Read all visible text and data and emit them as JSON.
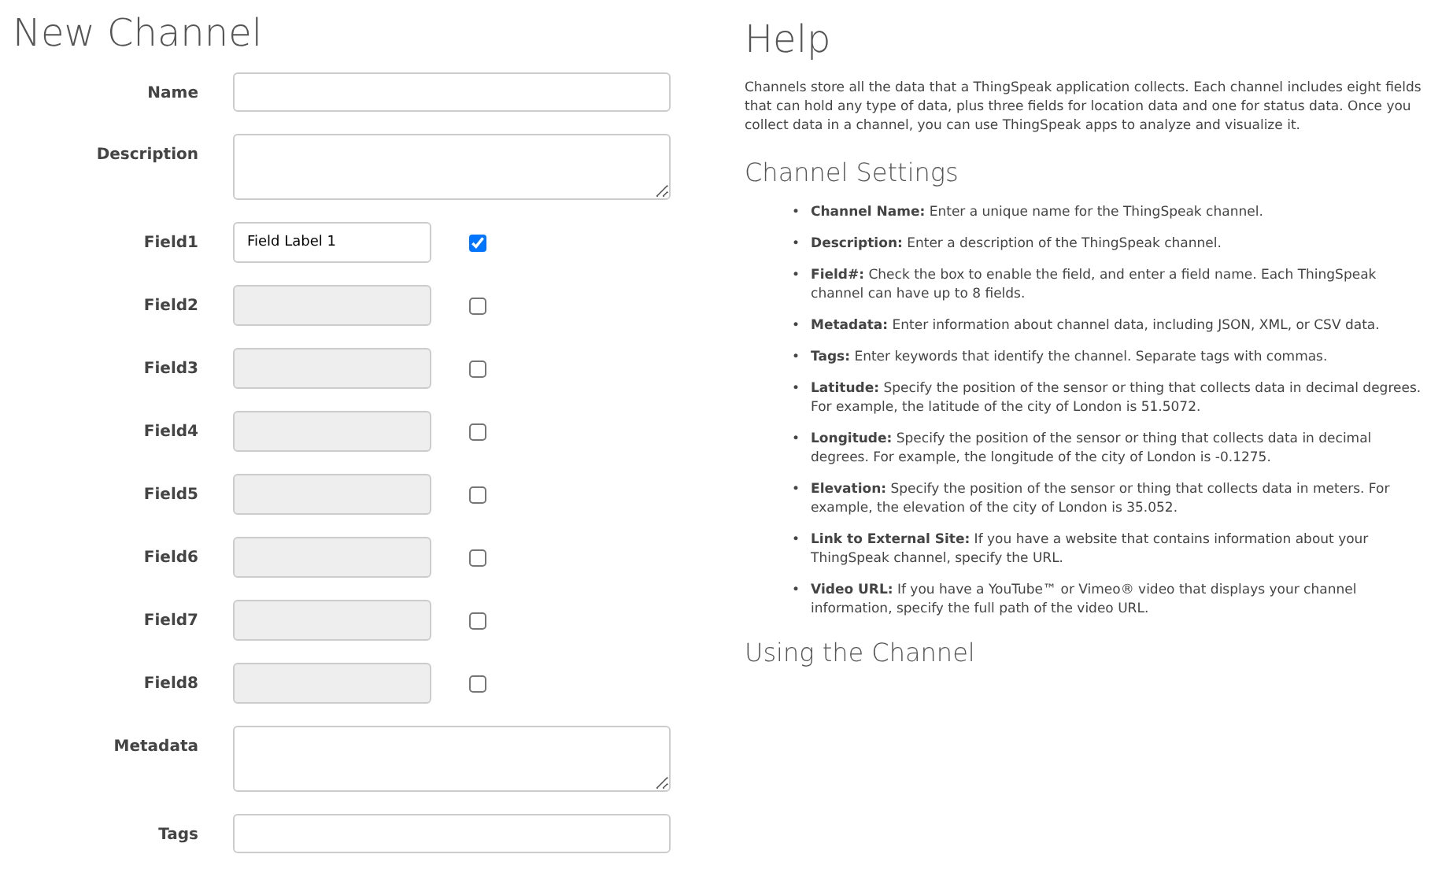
{
  "form": {
    "title": "New Channel",
    "fields": [
      {
        "kind": "input",
        "label": "Name"
      },
      {
        "kind": "textarea",
        "label": "Description"
      },
      {
        "kind": "field",
        "label": "Field1",
        "value": "Field Label 1",
        "checked": true,
        "disabled": false
      },
      {
        "kind": "field",
        "label": "Field2",
        "checked": false,
        "disabled": true
      },
      {
        "kind": "field",
        "label": "Field3",
        "checked": false,
        "disabled": true
      },
      {
        "kind": "field",
        "label": "Field4",
        "checked": false,
        "disabled": true
      },
      {
        "kind": "field",
        "label": "Field5",
        "checked": false,
        "disabled": true
      },
      {
        "kind": "field",
        "label": "Field6",
        "checked": false,
        "disabled": true
      },
      {
        "kind": "field",
        "label": "Field7",
        "checked": false,
        "disabled": true
      },
      {
        "kind": "field",
        "label": "Field8",
        "checked": false,
        "disabled": true
      },
      {
        "kind": "textarea",
        "label": "Metadata"
      },
      {
        "kind": "input",
        "label": "Tags"
      }
    ]
  },
  "help": {
    "title": "Help",
    "intro": "Channels store all the data that a ThingSpeak application collects. Each channel includes eight fields that can hold any type of data, plus three fields for location data and one for status data. Once you collect data in a channel, you can use ThingSpeak apps to analyze and visualize it.",
    "sections": [
      {
        "title": "Channel Settings",
        "items": [
          {
            "bullet": "•",
            "text": "**Channel Name:** Enter a unique name for the ThingSpeak channel."
          },
          {
            "bullet": "•",
            "text": "**Description:** Enter a description of the ThingSpeak channel."
          },
          {
            "bullet": "•",
            "text": "**Field#:** Check the box to enable the field, and enter a field name. Each ThingSpeak channel can have up to 8 fields."
          },
          {
            "bullet": "•",
            "text": "**Metadata:** Enter information about channel data, including JSON, XML, or CSV data."
          },
          {
            "bullet": "•",
            "text": "**Tags:** Enter keywords that identify the channel. Separate tags with commas."
          },
          {
            "bullet": "•",
            "text": "**Latitude:** Specify the position of the sensor or thing that collects data in decimal degrees. For example, the latitude of the city of London is 51.5072."
          },
          {
            "bullet": "•",
            "text": "**Longitude:** Specify the position of the sensor or thing that collects data in decimal degrees. For example, the longitude of the city of London is -0.1275."
          },
          {
            "bullet": "•",
            "text": "**Elevation:** Specify the position of the sensor or thing that collects data in meters. For example, the elevation of the city of London is 35.052."
          },
          {
            "bullet": "•",
            "text": "**Link to External Site:** If you have a website that contains information about your ThingSpeak channel, specify the URL."
          },
          {
            "bullet": "•",
            "text": "**Video URL:** If you have a YouTube™ or Vimeo® video that displays your channel information, specify the full path of the video URL."
          }
        ]
      },
      {
        "title": "Using the Channel"
      }
    ]
  }
}
